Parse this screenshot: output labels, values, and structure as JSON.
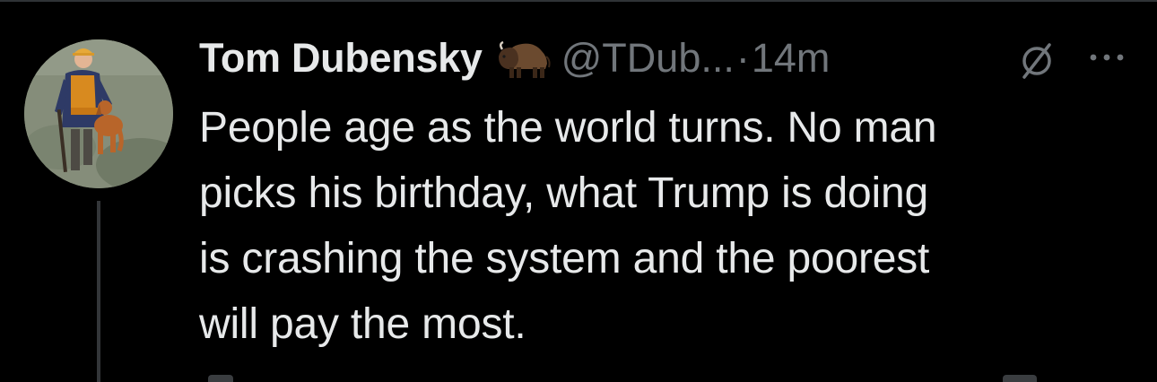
{
  "tweet": {
    "author": {
      "display_name": "Tom Dubensky",
      "badge_emoji": "bison-emoji",
      "handle": "@TDub...",
      "avatar": "avatar-photo-hunter-with-dog"
    },
    "separator": "·",
    "timestamp": "14m",
    "text": "People age as the world turns. No man\npicks his birthday, what Trump is doing\nis crashing the system and the poorest\nwill pay the most.",
    "actions": {
      "grok_icon": "grok-icon",
      "more_icon": "more-icon"
    }
  },
  "colors": {
    "background": "#000000",
    "primary_text": "#e7e9ea",
    "secondary_text": "#71767b",
    "thread_line": "#333639"
  }
}
